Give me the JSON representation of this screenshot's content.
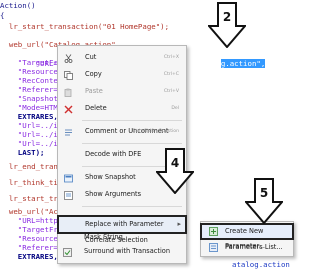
{
  "code": {
    "lines": [
      {
        "text": "Action()",
        "cls": "ln-fn"
      },
      {
        "text": "{",
        "cls": "ln-fn"
      },
      {
        "text": "  lr_start_transaction(\"01 HomePage\");",
        "cls": "ln-red"
      },
      {
        "text": "",
        "cls": ""
      },
      {
        "text": "  web_url(\"Catalog.action\",",
        "cls": "ln-red"
      },
      {
        "text": "    \"URL=",
        "cls": "ln-str"
      },
      {
        "text": "    \"TargetFr",
        "cls": "ln-str"
      },
      {
        "text": "    \"Resource",
        "cls": "ln-str"
      },
      {
        "text": "    \"RecConte",
        "cls": "ln-str"
      },
      {
        "text": "    \"Referer=",
        "cls": "ln-str"
      },
      {
        "text": "    \"Snapshot",
        "cls": "ln-str"
      },
      {
        "text": "    \"Mode=HTM",
        "cls": "ln-str"
      },
      {
        "text": "    EXTRARES,",
        "cls": "ln-kw"
      },
      {
        "text": "    \"Url=../i",
        "cls": "ln-str"
      },
      {
        "text": "    \"Url=../i",
        "cls": "ln-str"
      },
      {
        "text": "    \"Url=../i",
        "cls": "ln-str"
      },
      {
        "text": "    LAST);",
        "cls": "ln-kw"
      },
      {
        "text": "",
        "cls": ""
      },
      {
        "text": "  lr_end_transa",
        "cls": "ln-red"
      },
      {
        "text": "",
        "cls": ""
      },
      {
        "text": "  lr_think_time",
        "cls": "ln-red"
      },
      {
        "text": "",
        "cls": ""
      },
      {
        "text": "  lr_start_tran",
        "cls": "ln-red"
      },
      {
        "text": "",
        "cls": ""
      },
      {
        "text": "  web_url(\"Accou",
        "cls": "ln-red"
      },
      {
        "text": "    \"URL=http",
        "cls": "ln-str"
      },
      {
        "text": "    \"TargetFr",
        "cls": "ln-str"
      },
      {
        "text": "    \"Resource",
        "cls": "ln-str"
      },
      {
        "text": "    \"RecConte",
        "cls": "ln-str"
      },
      {
        "text": "    \"Referer=",
        "cls": "ln-str"
      },
      {
        "text": "    \"Snapshot",
        "cls": "ln-str"
      },
      {
        "text": "    \"Mode=HTM",
        "cls": "ln-str"
      },
      {
        "text": "    EXTRARES,",
        "cls": "ln-kw"
      }
    ],
    "selection_text": "http",
    "selection_tail": "g.action\",",
    "lower_tail": "atalog.action"
  },
  "context_menu": {
    "items": [
      {
        "label": "Cut",
        "shortcut": "Ctrl+X",
        "icon": "cut-icon",
        "disabled": false
      },
      {
        "label": "Copy",
        "shortcut": "Ctrl+C",
        "icon": "copy-icon",
        "disabled": false
      },
      {
        "label": "Paste",
        "shortcut": "Ctrl+V",
        "icon": "paste-icon",
        "disabled": true
      },
      {
        "label": "Delete",
        "shortcut": "Del",
        "icon": "delete-icon",
        "disabled": false
      },
      {
        "label": "Comment or Uncomment",
        "shortcut": "Ctrl+Shift+Question",
        "icon": "comment-icon",
        "disabled": false
      },
      {
        "label": "Decode with DFE",
        "shortcut": "",
        "icon": "",
        "disabled": false
      },
      {
        "label": "Show Snapshot",
        "shortcut": "",
        "icon": "snapshot-icon",
        "disabled": false
      },
      {
        "label": "Show Arguments",
        "shortcut": "",
        "icon": "arguments-icon",
        "disabled": false
      },
      {
        "label": "Replace with Parameter",
        "shortcut": "",
        "icon": "",
        "disabled": false
      },
      {
        "label": "Correlate Selection",
        "shortcut": "",
        "icon": "",
        "disabled": false
      },
      {
        "label": "Mask String",
        "shortcut": "",
        "icon": "",
        "disabled": false
      },
      {
        "label": "Surround with Transaction",
        "shortcut": "",
        "icon": "transaction-icon",
        "disabled": false
      }
    ],
    "submenu_arrow": "▸"
  },
  "submenu": {
    "items": [
      {
        "label": "Create New Parameter...",
        "icon": "create-parameter-icon"
      },
      {
        "label": "Parameters List...",
        "icon": "parameters-list-icon"
      }
    ]
  },
  "callouts": {
    "step2": "2",
    "step4": "4",
    "step5": "5"
  },
  "colors": {
    "selection": "#3399ff",
    "menu_bg": "#f5f5f5",
    "callout_fill": "#ffffff",
    "callout_stroke": "#111111"
  }
}
